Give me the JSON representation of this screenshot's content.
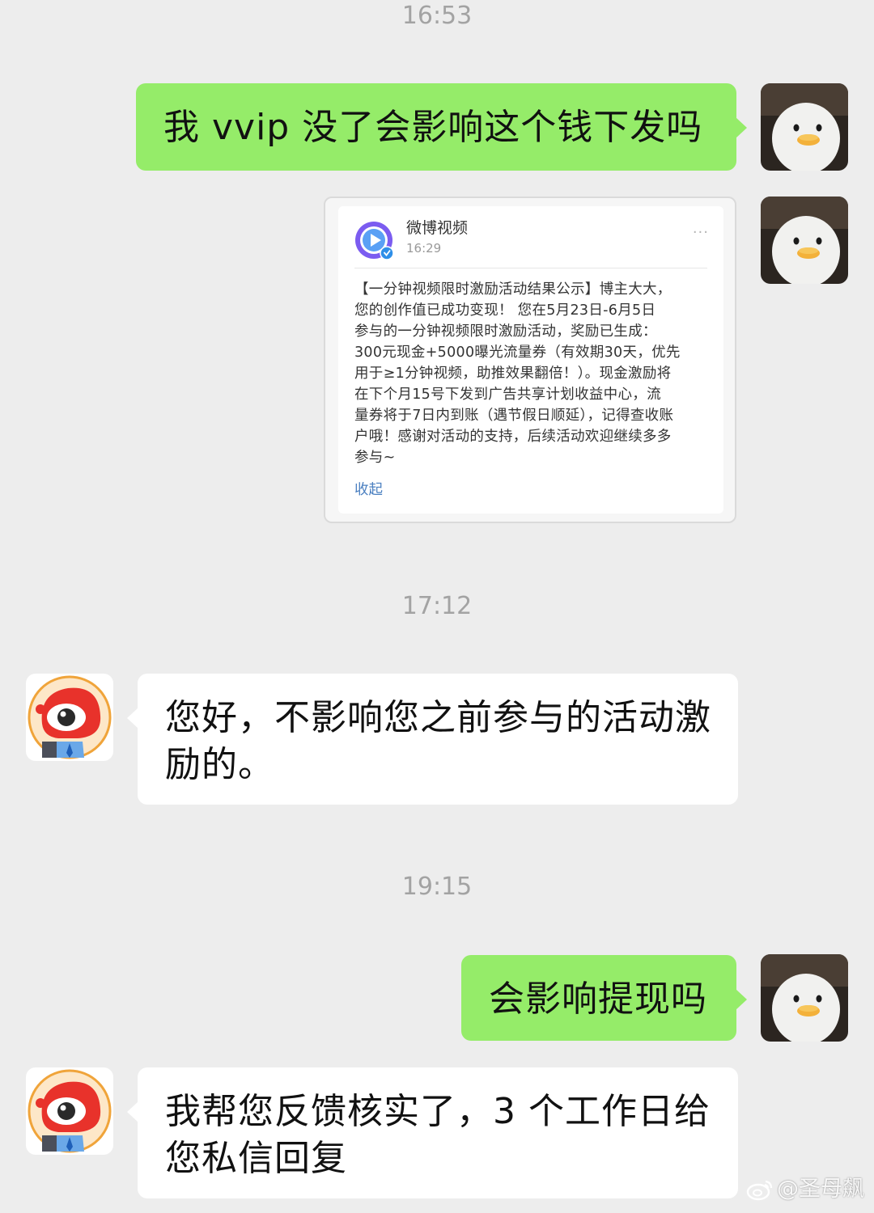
{
  "timestamps": [
    "16:53",
    "17:12",
    "19:15"
  ],
  "messages": {
    "m1": "我 vvip 没了会影响这个钱下发吗",
    "m2": "您好，不影响您之前参与的活动激励的。",
    "m3": "会影响提现吗",
    "m4": "我帮您反馈核实了，3 个工作日给您私信回复"
  },
  "shared_card": {
    "account_name": "微博视频",
    "time": "16:29",
    "body": "【一分钟视频限时激励活动结果公示】博主大大，\n您的创作值已成功变现！ 您在5月23日-6月5日\n参与的一分钟视频限时激励活动，奖励已生成：\n300元现金+5000曝光流量券（有效期30天，优先\n用于≥1分钟视频，助推效果翻倍！）。现金激励将\n在下个月15号下发到广告共享计划收益中心，流\n量券将于7日内到账（遇节假日顺延），记得查收账\n户哦！感谢对活动的支持，后续活动欢迎继续多多\n参与~",
    "collapse_label": "收起",
    "more": "···"
  },
  "watermark": "@圣母飙",
  "colors": {
    "background": "#ededed",
    "outgoing_bubble": "#95ec69",
    "incoming_bubble": "#ffffff",
    "timestamp_text": "#a3a3a3",
    "link": "#4a7fc0"
  },
  "icons": {
    "self_avatar": "white-duck-avatar",
    "service_avatar": "weibo-mascot-avatar",
    "card_logo": "weibo-video-logo",
    "watermark_logo": "weibo-logo"
  }
}
